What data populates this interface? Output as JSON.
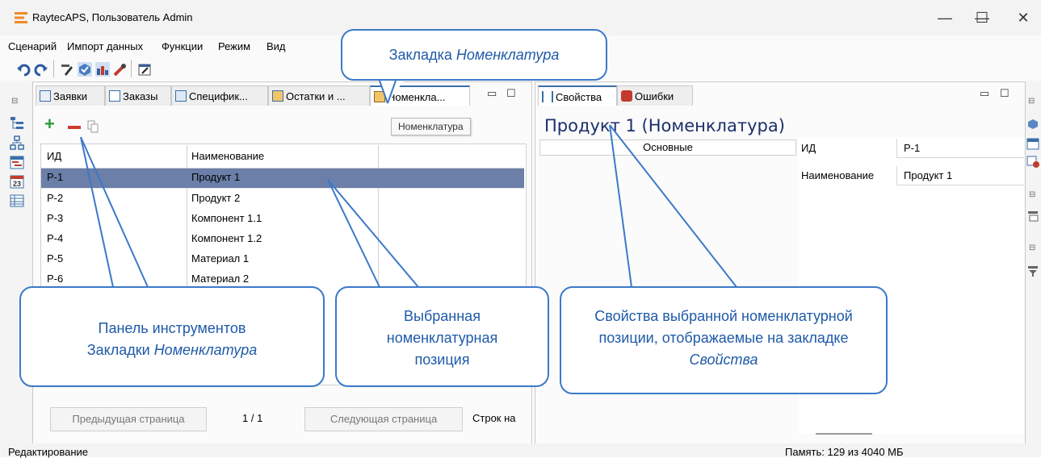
{
  "window": {
    "title": "RaytecAPS, Пользователь Admin",
    "min_glyph": "—",
    "max_glyph": "☐",
    "close_glyph": "✕"
  },
  "menu": [
    "Сценарий",
    "Импорт данных",
    "Функции",
    "Режим",
    "Вид"
  ],
  "left_panel": {
    "tabs": [
      "Заявки",
      "Заказы",
      "Специфик...",
      "Остатки и ...",
      "Номенкла..."
    ],
    "tooltip": "Номенклатура",
    "columns": [
      "ИД",
      "Наименование"
    ],
    "rows": [
      {
        "id": "P-1",
        "name": "Продукт 1",
        "selected": true
      },
      {
        "id": "P-2",
        "name": "Продукт 2"
      },
      {
        "id": "P-3",
        "name": "Компонент 1.1"
      },
      {
        "id": "P-4",
        "name": "Компонент 1.2"
      },
      {
        "id": "P-5",
        "name": "Материал 1"
      },
      {
        "id": "P-6",
        "name": "Материал 2"
      }
    ],
    "pager": {
      "prev": "Предыдущая страница",
      "page": "1 / 1",
      "next": "Следующая страница",
      "rows_label": "Строк на"
    }
  },
  "right_panel": {
    "tabs": [
      "Свойства",
      "Ошибки"
    ],
    "title": "Продукт 1 (Номенклатура)",
    "group": "Основные",
    "props": [
      {
        "label": "ИД",
        "value": "P-1"
      },
      {
        "label": "Наименование",
        "value": "Продукт 1"
      }
    ]
  },
  "status": {
    "left": "Редактирование",
    "right": "Память: 129 из 4040 МБ"
  },
  "callouts": {
    "tab": {
      "text": "Закладка ",
      "italic": "Номенклатура"
    },
    "toolbar": {
      "line1": "Панель инструментов",
      "line2": "Закладки ",
      "italic": "Номенклатура"
    },
    "selected": {
      "line1": "Выбранная",
      "line2": "номенклатурная",
      "line3": "позиция"
    },
    "props": {
      "line1": "Свойства выбранной номенклатурной",
      "line2": "позиции, отображаемые на закладке",
      "italic": "Свойства"
    }
  },
  "colors": {
    "accent": "#3b79c9",
    "selection": "#6b7fa8",
    "title_blue": "#1b2f6b"
  }
}
